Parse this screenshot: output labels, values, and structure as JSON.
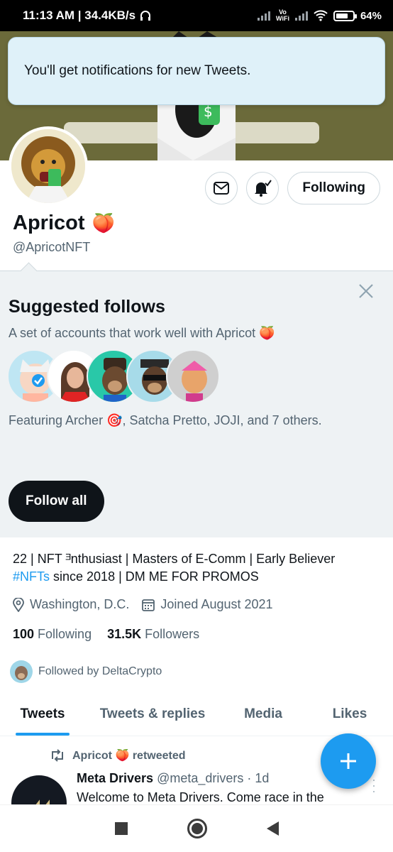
{
  "status_bar": {
    "time_speed": "11:13 AM | 34.4KB/s",
    "vowifi_top": "Vo",
    "vowifi_bottom": "WiFi",
    "battery": "64%"
  },
  "toast": {
    "message": "You'll get notifications for new Tweets."
  },
  "profile": {
    "display_name": "Apricot",
    "name_emoji": "🍑",
    "handle": "@ApricotNFT",
    "following_button": "Following",
    "bio_line1": "22 | NFT ᴲnthusiast | Masters of E-Comm | Early Believer",
    "bio_hashtag": "#NFTs",
    "bio_line2_rest": " since 2018 | DM ME FOR PROMOS",
    "location": "Washington, D.C.",
    "joined": "Joined August 2021",
    "following_count": "100",
    "following_label": "Following",
    "followers_count": "31.5K",
    "followers_label": "Followers",
    "followed_by": "Followed by DeltaCrypto"
  },
  "suggested": {
    "title": "Suggested follows",
    "subtitle": "A set of accounts that work well with Apricot 🍑",
    "featuring": "Featuring Archer 🎯, Satcha Pretto, JOJI, and 7 others.",
    "follow_all": "Follow all"
  },
  "tabs": [
    {
      "label": "Tweets",
      "active": true
    },
    {
      "label": "Tweets & replies",
      "active": false
    },
    {
      "label": "Media",
      "active": false
    },
    {
      "label": "Likes",
      "active": false
    }
  ],
  "tweet": {
    "retweeted_by": "Apricot 🍑 retweeted",
    "author": "Meta Drivers",
    "author_handle": "@meta_drivers",
    "time": "· 1d",
    "text": "Welcome to Meta Drivers. Come race in the"
  },
  "colors": {
    "accent": "#1d9bf0",
    "banner": "#6b6a3a",
    "toast_bg": "#dff1f9",
    "suggested_bg": "#eef2f4"
  }
}
